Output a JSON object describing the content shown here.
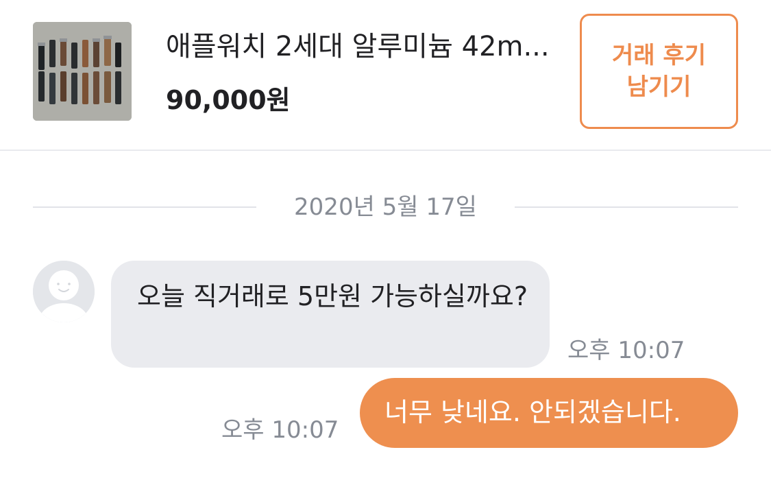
{
  "product": {
    "title": "애플워치 2세대 알루미늄 42m...",
    "price": "90,000원",
    "thumbnail_icon": "watch-bands-photo"
  },
  "review_button": {
    "line1": "거래 후기",
    "line2": "남기기"
  },
  "date_divider": "2020년 5월 17일",
  "messages": [
    {
      "direction": "incoming",
      "text": "오늘 직거래로 5만원 가능하실까요?",
      "time": "오후 10:07"
    },
    {
      "direction": "outgoing",
      "text": "너무 낮네요. 안되겠습니다.",
      "time": "오후 10:07"
    }
  ],
  "colors": {
    "accent": "#EE8B4D",
    "incoming_bubble": "#EAEBEF",
    "outgoing_bubble": "#EE8F4F",
    "meta_text": "#868B94"
  }
}
